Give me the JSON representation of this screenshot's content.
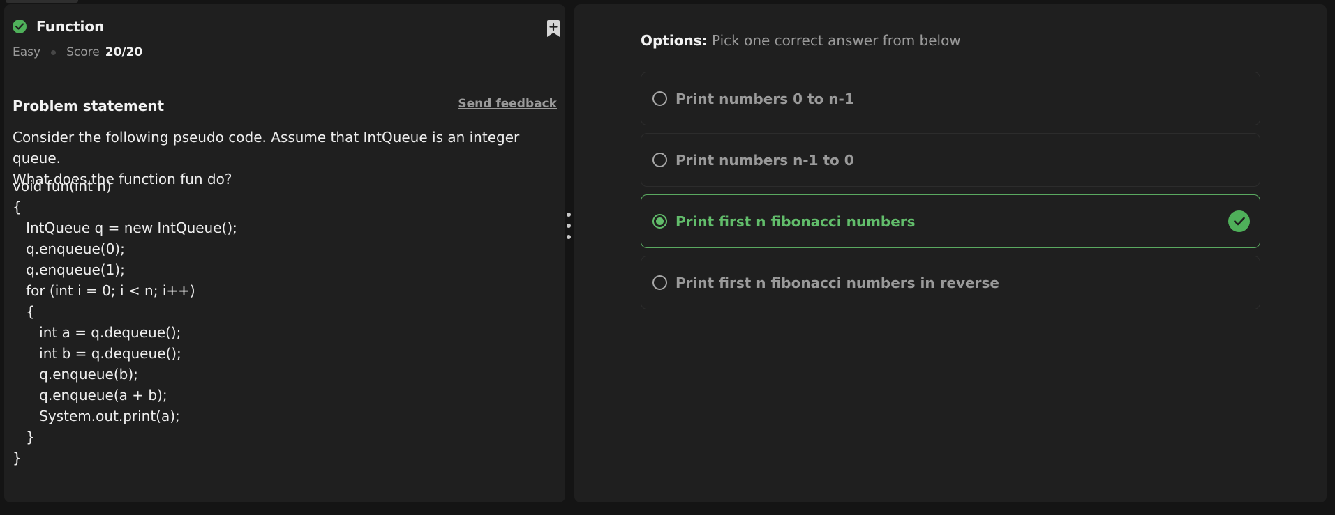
{
  "question": {
    "title": "Function",
    "difficulty": "Easy",
    "score_label": "Score",
    "score_value": "20/20"
  },
  "problem": {
    "heading": "Problem statement",
    "feedback_link": "Send feedback",
    "statement_line1": "Consider the following pseudo code. Assume that IntQueue is an integer queue.",
    "statement_line2": "What does the function fun do?",
    "code": [
      "void fun(int n)",
      "{",
      "   IntQueue q = new IntQueue();",
      "   q.enqueue(0);",
      "   q.enqueue(1);",
      "   for (int i = 0; i < n; i++)",
      "   {",
      "      int a = q.dequeue();",
      "      int b = q.dequeue();",
      "      q.enqueue(b);",
      "      q.enqueue(a + b);",
      "      System.out.print(a);",
      "   }",
      "}"
    ]
  },
  "options": {
    "label": "Options:",
    "hint": "Pick one correct answer from below",
    "items": [
      {
        "label": "Print numbers 0 to n-1",
        "selected": false,
        "correct": false
      },
      {
        "label": "Print numbers n-1 to 0",
        "selected": false,
        "correct": false
      },
      {
        "label": "Print first n fibonacci numbers",
        "selected": true,
        "correct": true
      },
      {
        "label": "Print first n fibonacci numbers in reverse",
        "selected": false,
        "correct": false
      }
    ]
  },
  "colors": {
    "accent_green": "#62bd6b",
    "panel_bg": "#1f1f1f",
    "page_bg": "#141414"
  },
  "icons": [
    "check-circle-icon",
    "bookmark-plus-icon",
    "splitter-handle-icon",
    "radio-icon",
    "correct-check-icon"
  ]
}
